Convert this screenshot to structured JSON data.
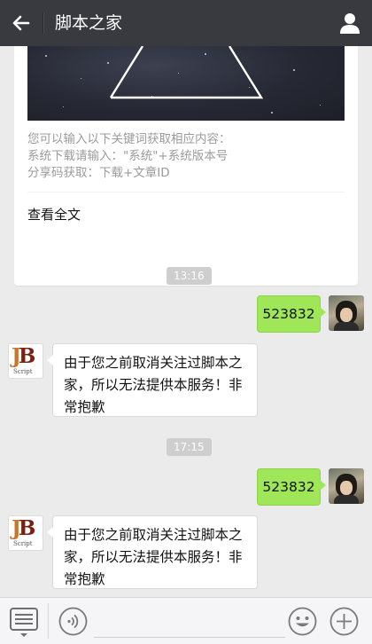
{
  "header": {
    "title": "脚本之家",
    "back_icon": "arrow-left-icon",
    "profile_icon": "person-icon"
  },
  "article_card": {
    "description_lines": [
      "您可以输入以下关键词获取相应内容：",
      "系统下载请输入：\"系统\"+系统版本号",
      "分享码获取：下载+文章ID"
    ],
    "read_full_label": "查看全文"
  },
  "messages": [
    {
      "type": "timestamp",
      "text": "13:16"
    },
    {
      "type": "outgoing",
      "text": "523832"
    },
    {
      "type": "incoming",
      "text": "由于您之前取消关注过脚本之家，所以无法提供本服务！非常抱歉"
    },
    {
      "type": "timestamp",
      "text": "17:15"
    },
    {
      "type": "outgoing",
      "text": "523832"
    },
    {
      "type": "incoming",
      "text": "由于您之前取消关注过脚本之家，所以无法提供本服务！非常抱歉"
    }
  ],
  "bot_avatar": {
    "logo_letters": "JB",
    "logo_sub": "Script"
  },
  "input_bar": {
    "menu_icon": "keyboard-menu-icon",
    "voice_icon": "voice-icon",
    "input_value": "",
    "emoji_icon": "emoji-icon",
    "plus_icon": "plus-icon"
  },
  "colors": {
    "header_bg": "#393a3f",
    "chat_bg": "#ebebeb",
    "outgoing_bubble": "#9fe658",
    "incoming_bubble": "#ffffff",
    "timestamp_bg": "#cecece"
  }
}
